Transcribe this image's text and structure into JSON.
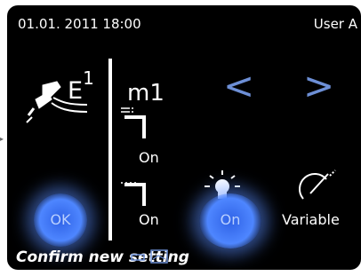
{
  "status": {
    "datetime": "01.01. 2011 18:00",
    "user": "User A"
  },
  "instrument": {
    "icon": "handpiece-icon",
    "label": "E",
    "index": "1"
  },
  "mode": {
    "label": "m1",
    "prev_icon": "<",
    "next_icon": ">"
  },
  "spray": {
    "icon": "spray-icon",
    "state": "On"
  },
  "air": {
    "icon": "air-icon",
    "state": "On"
  },
  "light": {
    "icon": "light-bulb-icon",
    "state": "On"
  },
  "speed": {
    "icon": "speed-gauge-icon",
    "label": "Variable"
  },
  "ok_button": {
    "label": "OK"
  },
  "footer": {
    "message": "Confirm new setting"
  },
  "colors": {
    "accent": "#4e86ff",
    "arrow": "#6d8fd6",
    "background": "#000000"
  }
}
